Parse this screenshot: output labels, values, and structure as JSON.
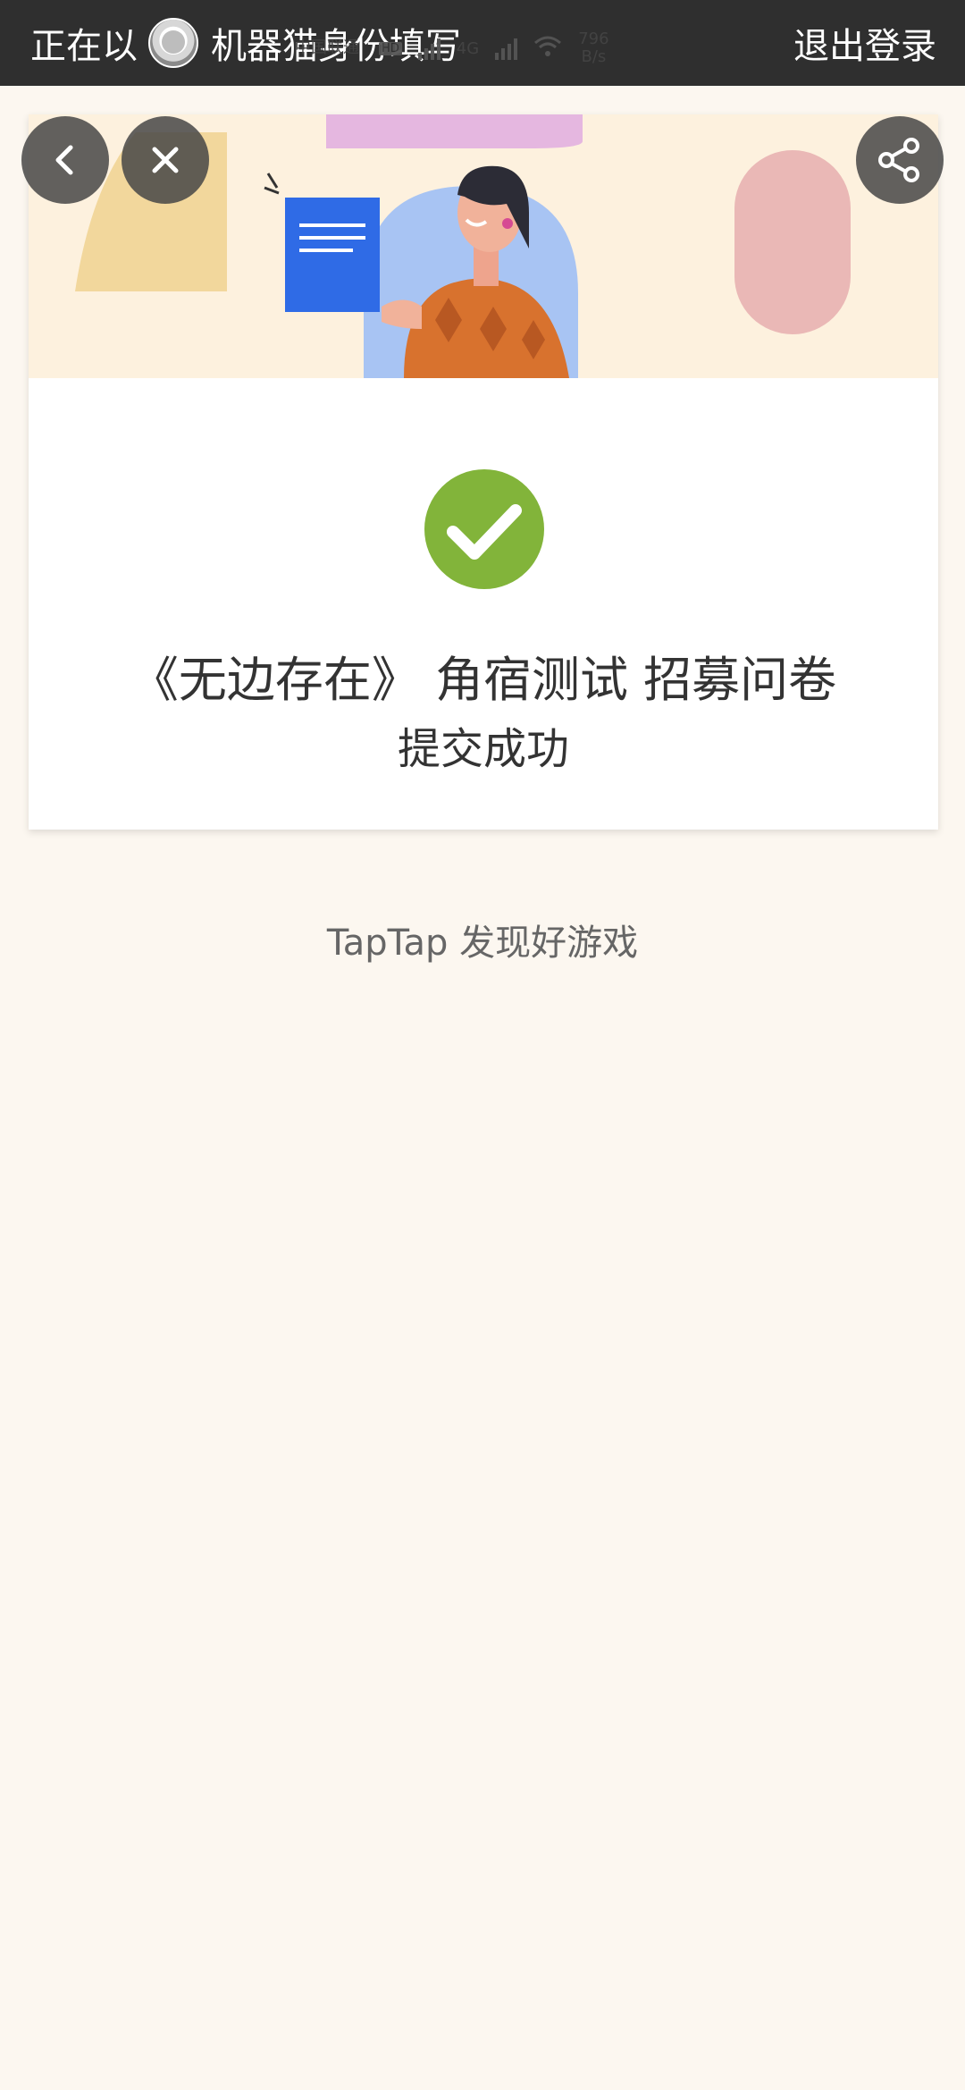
{
  "topbar": {
    "prefix": "正在以",
    "username": "机器猫",
    "suffix": "身份填写",
    "logout_label": "退出登录"
  },
  "system_status": {
    "carrier": "中国联通",
    "hd_badge": "HD",
    "network_type": "4G",
    "speed_value": "796",
    "speed_unit": "B/s"
  },
  "card": {
    "title": "《无边存在》 角宿测试 招募问卷",
    "status": "提交成功",
    "colors": {
      "success_green": "#82b43a",
      "banner_bg": "#fdf1de"
    }
  },
  "footer": {
    "tagline": "TapTap 发现好游戏"
  },
  "icons": {
    "back": "chevron-left-icon",
    "close": "close-icon",
    "share": "share-icon",
    "check": "checkmark-icon"
  }
}
